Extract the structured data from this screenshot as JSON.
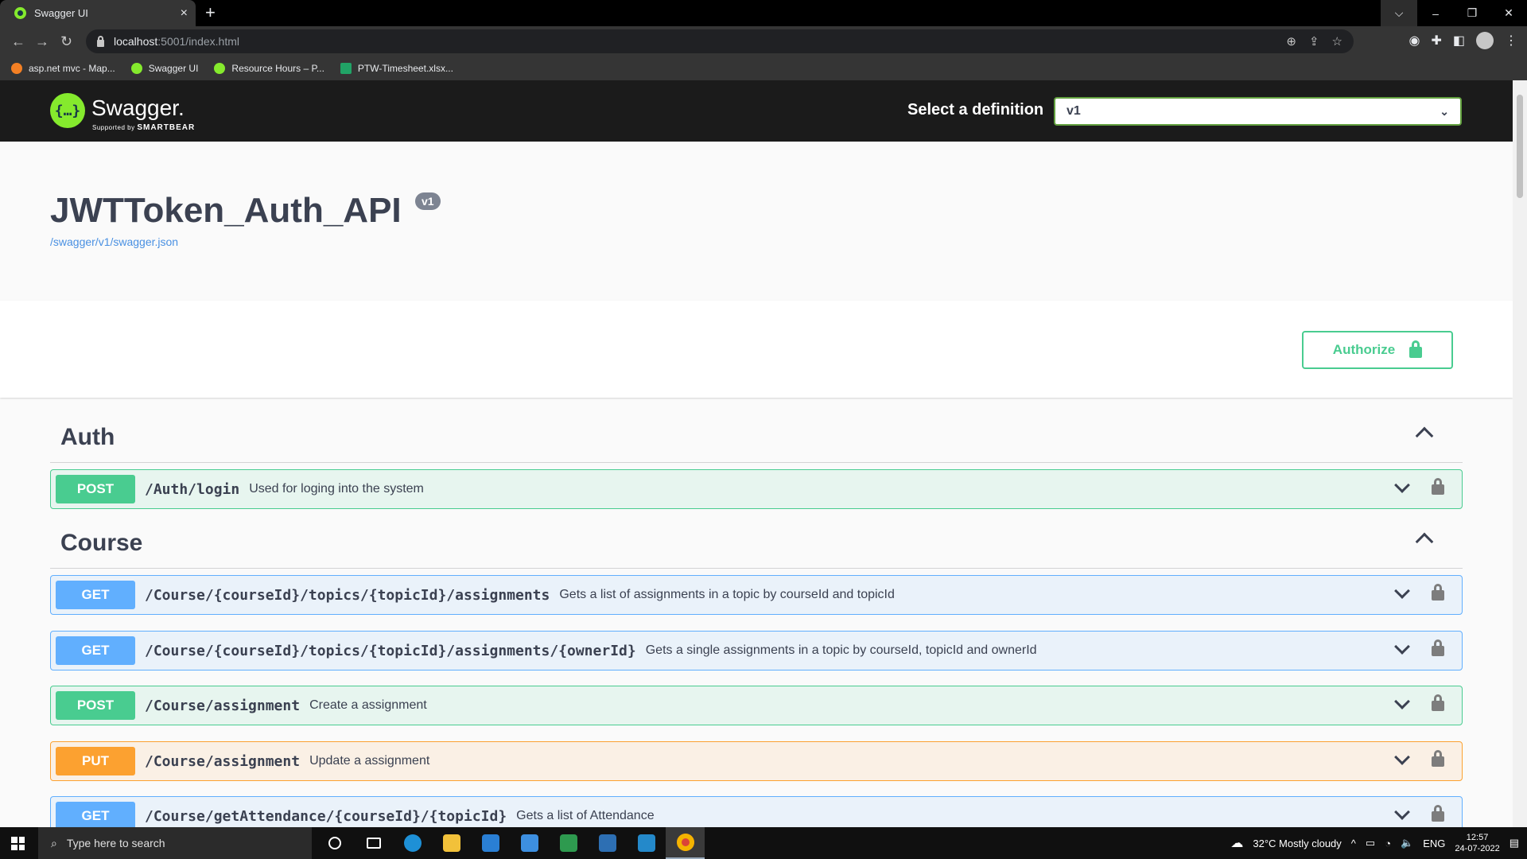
{
  "browser": {
    "tab_title": "Swagger UI",
    "tab_close": "×",
    "new_tab": "+",
    "url_host": "localhost",
    "url_path": ":5001/index.html",
    "window_controls": [
      "⌵",
      "–",
      "❐",
      "✕"
    ],
    "bookmarks": [
      {
        "label": "asp.net mvc - Map...",
        "color": "#f48024"
      },
      {
        "label": "Swagger UI",
        "color": "#85ea2d"
      },
      {
        "label": "Resource Hours – P...",
        "color": "#85ea2d"
      },
      {
        "label": "PTW-Timesheet.xlsx...",
        "color": "#21a366"
      }
    ]
  },
  "topbar": {
    "logo_glyph": "{…}",
    "logo_text": "Swagger.",
    "logo_sub_prefix": "Supported by",
    "logo_sub_brand": "SMARTBEAR",
    "definition_label": "Select a definition",
    "definition_value": "v1"
  },
  "info": {
    "title": "JWTToken_Auth_API",
    "version": "v1",
    "spec_link": "/swagger/v1/swagger.json"
  },
  "authorize_label": "Authorize",
  "tags": [
    {
      "name": "Auth",
      "operations": [
        {
          "method": "POST",
          "kind": "post",
          "path": "/Auth/login",
          "summary": "Used for loging into the system"
        }
      ]
    },
    {
      "name": "Course",
      "operations": [
        {
          "method": "GET",
          "kind": "get",
          "path": "/Course/{courseId}/topics/{topicId}/assignments",
          "summary": "Gets a list of assignments in a topic by courseId and topicId"
        },
        {
          "method": "GET",
          "kind": "get",
          "path": "/Course/{courseId}/topics/{topicId}/assignments/{ownerId}",
          "summary": "Gets a single assignments in a topic by courseId, topicId and ownerId"
        },
        {
          "method": "POST",
          "kind": "post",
          "path": "/Course/assignment",
          "summary": "Create a assignment"
        },
        {
          "method": "PUT",
          "kind": "put",
          "path": "/Course/assignment",
          "summary": "Update a assignment"
        },
        {
          "method": "GET",
          "kind": "get",
          "path": "/Course/getAttendance/{courseId}/{topicId}",
          "summary": "Gets a list of Attendance"
        }
      ]
    }
  ],
  "taskbar": {
    "search_placeholder": "Type here to search",
    "weather": "32°C  Mostly cloudy",
    "language": "ENG",
    "time": "12:57",
    "date": "24-07-2022"
  }
}
